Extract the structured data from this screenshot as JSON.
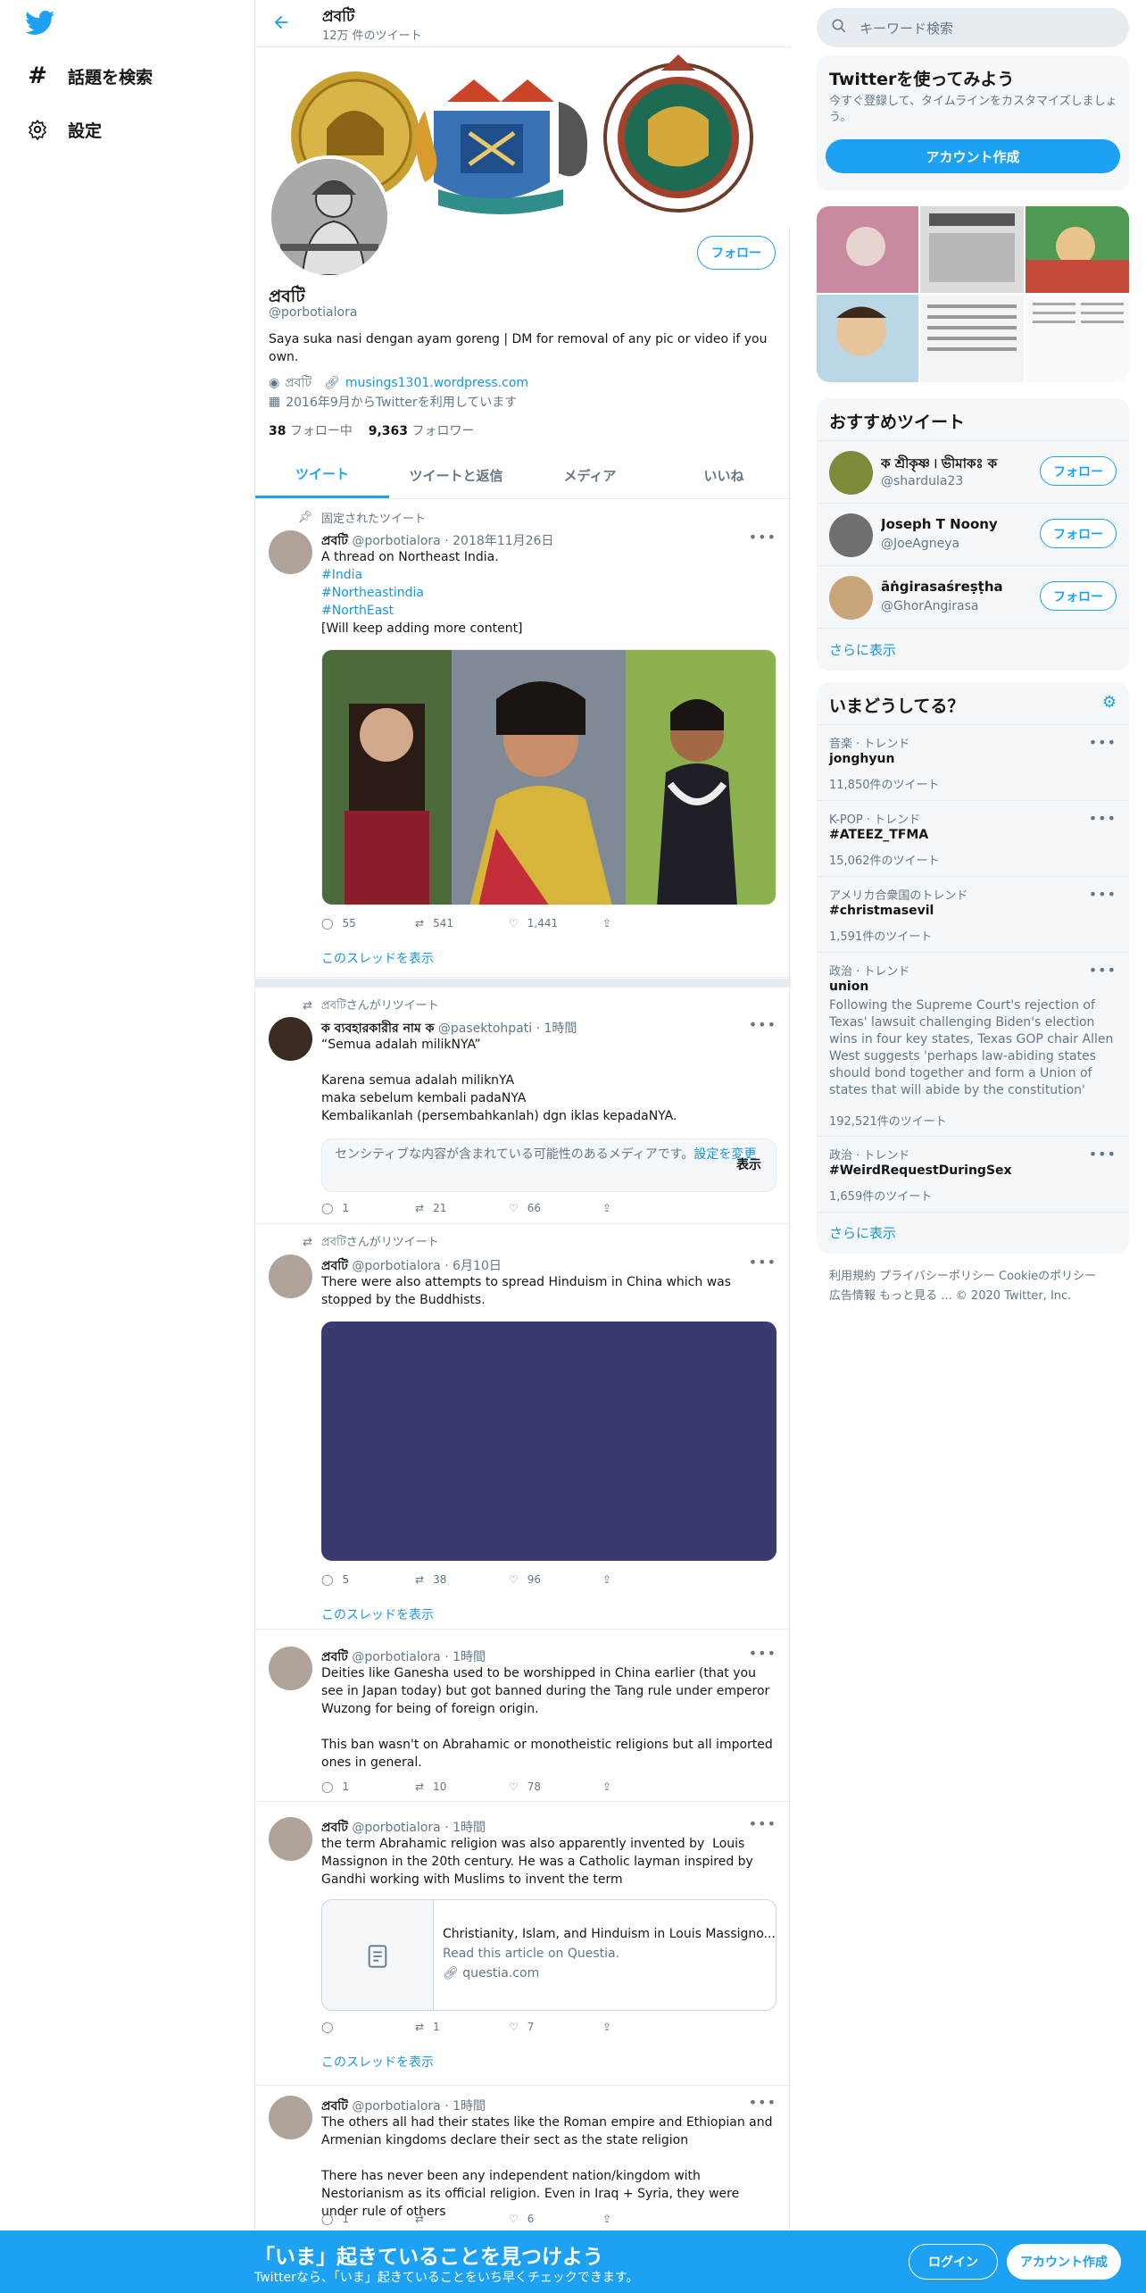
{
  "nav": {
    "explore": "話題を検索",
    "settings": "設定"
  },
  "header": {
    "name": "প্রবটি",
    "tweet_count": "12万 件のツイート"
  },
  "profile": {
    "name": "প্রবটি",
    "handle": "@porbotialora",
    "bio": "Saya suka nasi dengan ayam goreng | DM for removal of any pic or video if you own.",
    "location": "প্রবটি",
    "url": "musings1301.wordpress.com",
    "joined": "2016年9月からTwitterを利用しています",
    "following_count": "38",
    "following_label": "フォロー中",
    "followers_count": "9,363",
    "followers_label": "フォロワー",
    "follow_button": "フォロー"
  },
  "tabs": [
    "ツイート",
    "ツイートと返信",
    "メディア",
    "いいね"
  ],
  "tweets": [
    {
      "context": "固定されたツイート",
      "name": "প্রবটি",
      "handle": "@porbotialora",
      "time": "2018年11月26日",
      "text_main": "A thread on Northeast India.",
      "hashtags": [
        "#India",
        "#Northeastindia",
        "#NorthEast"
      ],
      "text_tail": "[Will keep adding more content]",
      "replies": "55",
      "retweets": "541",
      "likes": "1,441",
      "thread_link": "このスレッドを表示"
    },
    {
      "context": "প্রবটিさんがリツイート",
      "name": "ক ব্যবহারকারীর নাম ক",
      "handle": "@pasektohpati",
      "time": "1時間",
      "text": "“Semua adalah milikNYA”\n\nKarena semua adalah miliknYA\nmaka sebelum kembali padaNYA\nKembalikanlah (persembahkanlah) dgn iklas kepadaNYA.",
      "sensitive_text": "センシティブな内容が含まれている可能性のあるメディアです。",
      "sensitive_link": "設定を変更",
      "sensitive_show": "表示",
      "replies": "1",
      "retweets": "21",
      "likes": "66"
    },
    {
      "context": "প্রবটিさんがリツイート",
      "name": "প্রবটি",
      "handle": "@porbotialora",
      "time": "6月10日",
      "text": "There were also attempts to spread Hinduism in China which was stopped by the Buddhists.",
      "replies": "5",
      "retweets": "38",
      "likes": "96",
      "thread_link": "このスレッドを表示"
    },
    {
      "name": "প্রবটি",
      "handle": "@porbotialora",
      "time": "1時間",
      "text": "Deities like Ganesha used to be worshipped in China earlier (that you see in Japan today) but got banned during the Tang rule under emperor Wuzong for being of foreign origin.\n\nThis ban wasn't on Abrahamic or monotheistic religions but all imported ones in general.",
      "replies": "1",
      "retweets": "10",
      "likes": "78"
    },
    {
      "name": "প্রবটি",
      "handle": "@porbotialora",
      "time": "1時間",
      "text": "the term Abrahamic religion was also apparently invented by  Louis Massignon in the 20th century. He was a Catholic layman inspired by Gandhi working with Muslims to invent the term",
      "card_title": "Christianity, Islam, and Hinduism in Louis Massigno...",
      "card_desc": "Read this article on Questia.",
      "card_url": "questia.com",
      "replies": "",
      "retweets": "1",
      "likes": "7",
      "thread_link": "このスレッドを表示"
    },
    {
      "name": "প্রবটি",
      "handle": "@porbotialora",
      "time": "1時間",
      "text": "The others all had their states like the Roman empire and Ethiopian and Armenian kingdoms declare their sect as the state religion\n\nThere has never been any independent nation/kingdom with Nestorianism as its official religion. Even in Iraq + Syria, they were under rule of others",
      "replies": "1",
      "retweets": "",
      "likes": "6"
    }
  ],
  "right": {
    "search_placeholder": "キーワード検索",
    "signup_title": "Twitterを使ってみよう",
    "signup_desc": "今すぐ登録して、タイムラインをカスタマイズしましょう。",
    "signup_button": "アカウント作成",
    "recommend_title": "おすすめツイート",
    "recommend": [
      {
        "name": "ক শ্রীকৃষ্ণ ৷ ভীমাকঃ ক",
        "handle": "@shardula23",
        "button": "フォロー"
      },
      {
        "name": "Joseph T Noony",
        "handle": "@JoeAgneya",
        "button": "フォロー"
      },
      {
        "name": "āṅgirasaśreṣṭha",
        "handle": "@GhorAngirasa",
        "button": "フォロー"
      }
    ],
    "show_more": "さらに表示",
    "trends_title": "いまどうしてる？",
    "trends": [
      {
        "category": "音楽 · トレンド",
        "title": "jonghyun",
        "desc": "",
        "count": "11,850件のツイート"
      },
      {
        "category": "K-POP · トレンド",
        "title": "#ATEEZ_TFMA",
        "desc": "",
        "count": "15,062件のツイート"
      },
      {
        "category": "アメリカ合衆国のトレンド",
        "title": "#christmasevil",
        "desc": "",
        "count": "1,591件のツイート"
      },
      {
        "category": "政治 · トレンド",
        "title": "union",
        "desc": "Following the Supreme Court's rejection of Texas' lawsuit challenging Biden's election wins in four key states, Texas GOP chair Allen West suggests 'perhaps law-abiding states should bond together and form a Union of states that will abide by the constitution'",
        "count": "192,521件のツイート"
      },
      {
        "category": "政治 · トレンド",
        "title": "#WeirdRequestDuringSex",
        "desc": "",
        "count": "1,659件のツイート"
      }
    ],
    "trends_more": "さらに表示",
    "footer_line1": "利用規約   プライバシーポリシー   Cookieのポリシー",
    "footer_line2": "広告情報   もっと見る ...    © 2020 Twitter, Inc."
  },
  "bottom": {
    "title": "「いま」起きていることを見つけよう",
    "subtitle": "Twitterなら、「いま」起きていることをいち早くチェックできます。",
    "login": "ログイン",
    "signup": "アカウント作成"
  },
  "colors": {
    "accent": "#1da1f2",
    "link": "#1b95e0",
    "muted": "#657786",
    "media_placeholder": "#3b3a6e"
  }
}
